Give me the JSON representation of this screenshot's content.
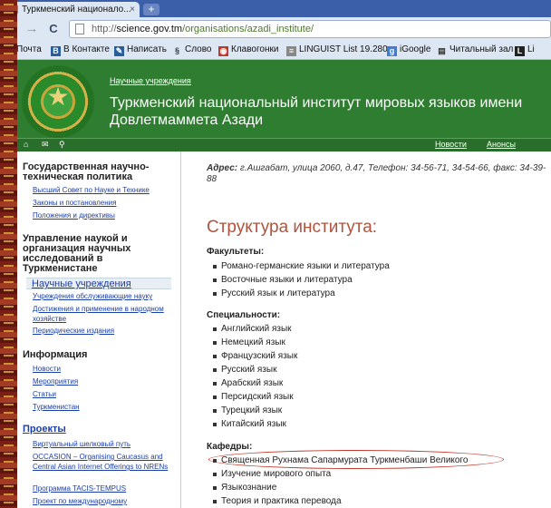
{
  "browser": {
    "tab_title": "Туркменский национало...",
    "tab_close": "×",
    "new_tab": "+",
    "url_scheme": "http://",
    "url_host": "science.gov.tm",
    "url_path": "/organisations/azadi_institute/",
    "back_icon": "←",
    "forward_icon": "→",
    "reload_icon": "C",
    "star_icon": "☆"
  },
  "bookmarks": [
    {
      "label": "Почта",
      "icon": "mail-icon",
      "color": "#c0392b"
    },
    {
      "label": "В Контакте",
      "icon": "vk-icon",
      "color": "#2a5d9b"
    },
    {
      "label": "Написать",
      "icon": "pen-icon",
      "color": "#2a5d9b"
    },
    {
      "label": "Слово",
      "icon": "word-icon",
      "color": "#333333"
    },
    {
      "label": "Клавогонки",
      "icon": "car-icon",
      "color": "#c0392b"
    },
    {
      "label": "LINGUIST List 19.280...",
      "icon": "list-icon",
      "color": "#888888"
    },
    {
      "label": "iGoogle",
      "icon": "google-icon",
      "color": "#3b7dd8"
    },
    {
      "label": "Читальный зал",
      "icon": "book-icon",
      "color": "#333333"
    },
    {
      "label": "Li",
      "icon": "li-icon",
      "color": "#333333"
    }
  ],
  "header": {
    "breadcrumb": "Научные учреждения",
    "title": "Туркменский национальный институт мировых языков имени Довлетмаммета Азади",
    "top_links": [
      "Новости",
      "Анонсы"
    ]
  },
  "sidebar": {
    "section1_title": "Государственная научно-техническая политика",
    "section1_links": [
      "Высший Совет по Науке и Технике",
      "Законы и постановления",
      "Положения и директивы"
    ],
    "section2_title": "Управление наукой и организация научных исследований в Туркменистане",
    "section2_active": "Научные учреждения",
    "section2_links": [
      "Учреждения обслуживающие науку",
      "Достижения и применение в народном хозяйстве",
      "Периодические издания"
    ],
    "section3_title": "Информация",
    "section3_links": [
      "Новости",
      "Мероприятия",
      "Статьи",
      "Туркменистан"
    ],
    "section4_title": "Проекты",
    "section4_links": [
      "Виртуальный шелковый путь",
      "OCCASION – Organising Caucasus and Central Asian Internet Offerings to NRENs",
      "Программа TACIS-TEMPUS",
      "Проект по международному"
    ]
  },
  "main": {
    "address_label": "Адрес:",
    "address_value": "г.Ашгабат, улица 2060, д.47, Телефон: 34-56-71, 34-54-66, факс: 34-39-88",
    "title": "Структура института:",
    "faculties_label": "Факультеты:",
    "faculties": [
      "Романо-германские языки и литература",
      "Восточные языки и литература",
      "Русский язык и литература"
    ],
    "specialties_label": "Специальности:",
    "specialties": [
      "Английский язык",
      "Немецкий язык",
      "Французский язык",
      "Русский язык",
      "Арабский язык",
      "Персидский язык",
      "Турецкий язык",
      "Китайский язык"
    ],
    "departments_label": "Кафедры:",
    "departments": [
      "Священная Рухнама Сапармурата Туркменбаши Великого",
      "Изучение мирового опыта",
      "Языкознание",
      "Теория и практика перевода"
    ]
  }
}
